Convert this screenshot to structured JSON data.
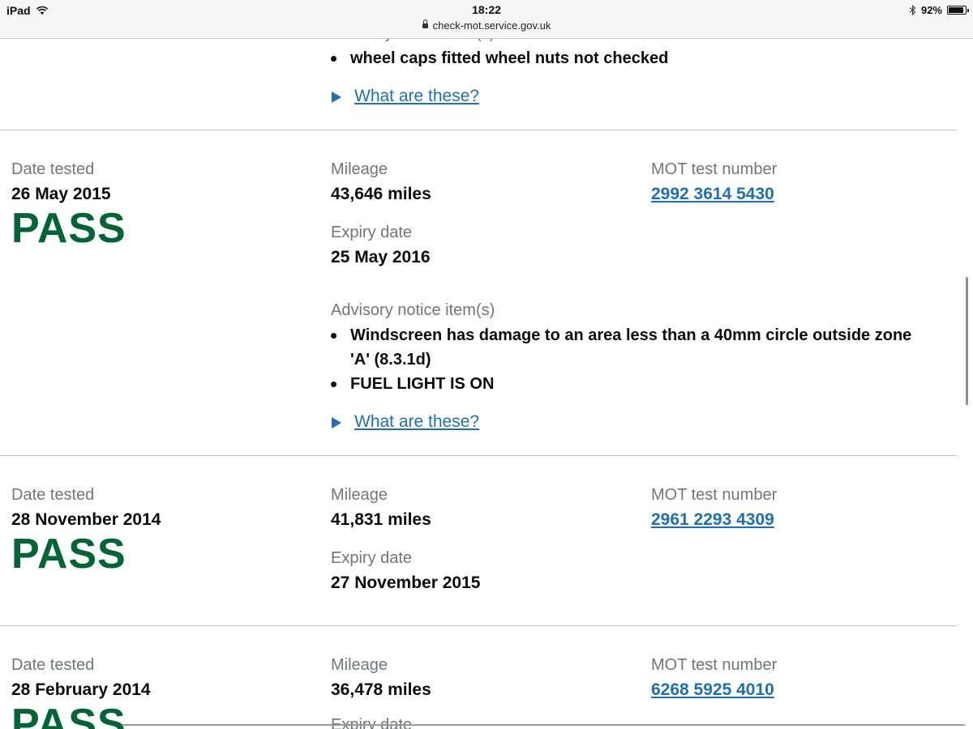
{
  "status_bar": {
    "device": "iPad",
    "time": "18:22",
    "url": "check-mot.service.gov.uk",
    "battery": "92%",
    "battery_level": 0.92
  },
  "top_section": {
    "advisory_heading": "Advisory notice item(s)",
    "advisories": [
      "wheel caps fitted wheel nuts not checked"
    ],
    "details_link": "What are these?"
  },
  "tests": [
    {
      "date_label": "Date tested",
      "date": "26 May 2015",
      "result": "PASS",
      "mileage_label": "Mileage",
      "mileage": "43,646 miles",
      "test_number_label": "MOT test number",
      "test_number": "2992 3614 5430",
      "expiry_label": "Expiry date",
      "expiry": "25 May 2016",
      "advisory_heading": "Advisory notice item(s)",
      "advisories": [
        "Windscreen has damage to an area less than a 40mm circle outside zone 'A' (8.3.1d)",
        "FUEL LIGHT IS ON"
      ],
      "details_link": "What are these?"
    },
    {
      "date_label": "Date tested",
      "date": "28 November 2014",
      "result": "PASS",
      "mileage_label": "Mileage",
      "mileage": "41,831 miles",
      "test_number_label": "MOT test number",
      "test_number": "2961 2293 4309",
      "expiry_label": "Expiry date",
      "expiry": "27 November 2015"
    },
    {
      "date_label": "Date tested",
      "date": "28 February 2014",
      "result": "PASS",
      "mileage_label": "Mileage",
      "mileage": "36,478 miles",
      "test_number_label": "MOT test number",
      "test_number": "6268 5925 4010",
      "expiry_label": "Expiry date"
    }
  ]
}
